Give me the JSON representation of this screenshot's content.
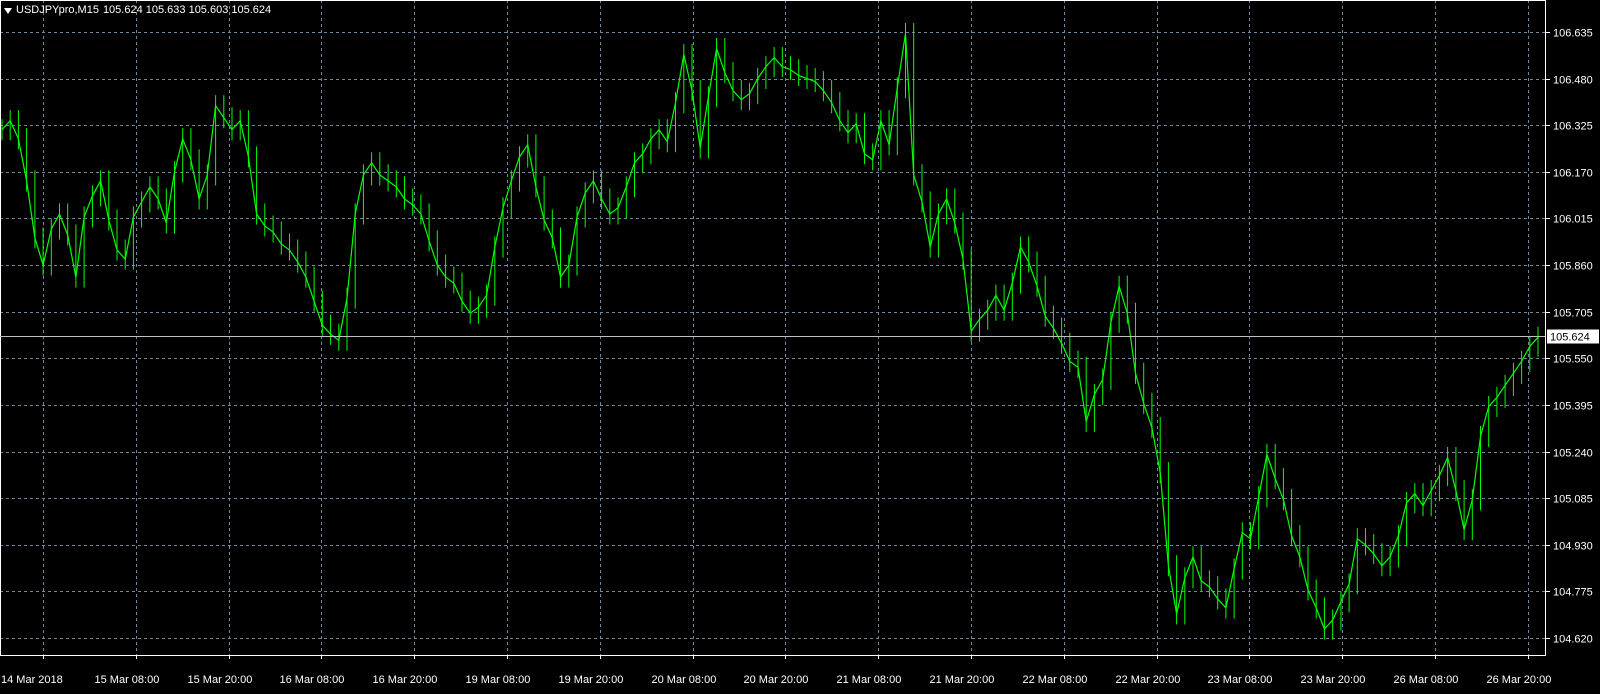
{
  "symbol": "USDJPYpro,M15",
  "ohlc_values": "105.624 105.633 105.603 105.624",
  "colors": {
    "background": "#000000",
    "candles": "#00ff00",
    "grid": "#6f87a0",
    "axis": "#ffffff",
    "text": "#ffffff"
  },
  "chart_data": {
    "type": "line",
    "title": "USDJPYpro,M15",
    "xlabel": "",
    "ylabel": "",
    "grid": true,
    "ylim": [
      104.575,
      106.69
    ],
    "y_ticks": [
      "106.635",
      "106.480",
      "106.325",
      "106.170",
      "106.015",
      "105.860",
      "105.705",
      "105.550",
      "105.395",
      "105.240",
      "105.085",
      "104.930",
      "104.775",
      "104.620"
    ],
    "x_ticks": [
      "14 Mar 2018",
      "15 Mar 08:00",
      "15 Mar 20:00",
      "16 Mar 08:00",
      "16 Mar 20:00",
      "19 Mar 08:00",
      "19 Mar 20:00",
      "20 Mar 08:00",
      "20 Mar 20:00",
      "21 Mar 08:00",
      "21 Mar 20:00",
      "22 Mar 08:00",
      "22 Mar 20:00",
      "23 Mar 08:00",
      "23 Mar 20:00",
      "26 Mar 08:00",
      "26 Mar 20:00"
    ],
    "current_price": "105.624",
    "series": [
      {
        "values": [
          106.31,
          106.34,
          106.28,
          106.14,
          105.95,
          105.86,
          105.98,
          106.03,
          105.96,
          105.82,
          106.02,
          106.09,
          106.14,
          106.01,
          105.91,
          105.88,
          106.02,
          106.07,
          106.12,
          106.08,
          106.0,
          106.17,
          106.28,
          106.21,
          106.08,
          106.16,
          106.39,
          106.35,
          106.31,
          106.34,
          106.22,
          106.03,
          105.99,
          105.97,
          105.93,
          105.91,
          105.87,
          105.82,
          105.74,
          105.66,
          105.63,
          105.61,
          105.75,
          106.03,
          106.16,
          106.2,
          106.16,
          106.14,
          106.12,
          106.08,
          106.06,
          106.03,
          105.94,
          105.86,
          105.82,
          105.8,
          105.74,
          105.7,
          105.72,
          105.76,
          105.92,
          106.05,
          106.14,
          106.22,
          106.26,
          106.12,
          106.01,
          105.95,
          105.82,
          105.86,
          106.02,
          106.1,
          106.14,
          106.08,
          106.03,
          106.05,
          106.12,
          106.2,
          106.23,
          106.28,
          106.31,
          106.27,
          106.4,
          106.56,
          106.44,
          106.25,
          106.42,
          106.58,
          106.5,
          106.44,
          106.41,
          106.43,
          106.48,
          106.52,
          106.55,
          106.52,
          106.51,
          106.49,
          106.48,
          106.47,
          106.44,
          106.4,
          106.34,
          106.3,
          106.33,
          106.23,
          106.21,
          106.34,
          106.26,
          106.45,
          106.63,
          106.16,
          106.07,
          105.92,
          106.03,
          106.08,
          106.0,
          105.88,
          105.64,
          105.68,
          105.71,
          105.76,
          105.71,
          105.8,
          105.92,
          105.87,
          105.79,
          105.69,
          105.65,
          105.6,
          105.54,
          105.52,
          105.34,
          105.43,
          105.48,
          105.67,
          105.79,
          105.7,
          105.5,
          105.4,
          105.32,
          105.17,
          104.86,
          104.7,
          104.82,
          104.89,
          104.81,
          104.79,
          104.75,
          104.72,
          104.85,
          104.97,
          104.95,
          105.09,
          105.23,
          105.15,
          105.08,
          104.96,
          104.89,
          104.78,
          104.72,
          104.65,
          104.68,
          104.74,
          104.8,
          104.95,
          104.93,
          104.9,
          104.86,
          104.89,
          104.96,
          105.07,
          105.1,
          105.06,
          105.11,
          105.16,
          105.22,
          105.11,
          104.98,
          105.08,
          105.29,
          105.39,
          105.42,
          105.46,
          105.5,
          105.54,
          105.59,
          105.62
        ]
      }
    ]
  }
}
